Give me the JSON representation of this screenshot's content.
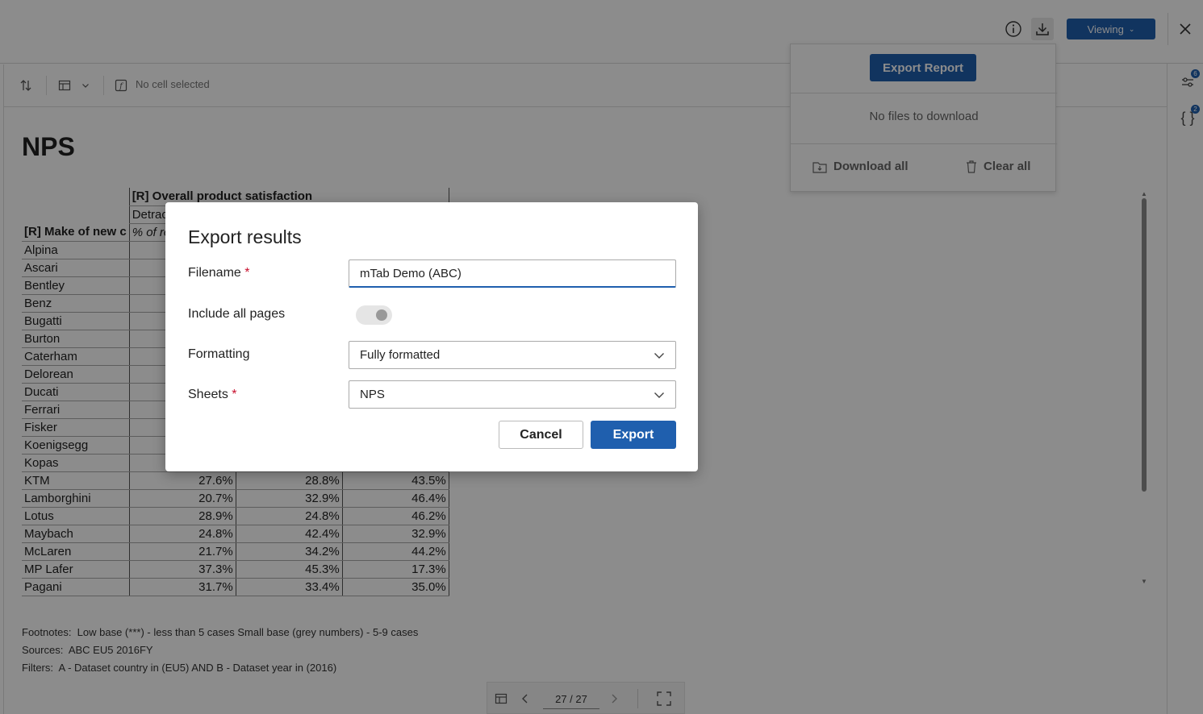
{
  "header": {
    "info_icon": "info-icon",
    "download_icon": "download-icon",
    "viewing_label": "Viewing",
    "close_icon": "close-icon"
  },
  "toolbar": {
    "sort_icon": "sort-icon",
    "table_icon": "table-icon",
    "formula_icon": "formula-icon",
    "cell_status": "No cell selected"
  },
  "right_rail": {
    "filters_badge": "6",
    "variables_badge": "2"
  },
  "page": {
    "title": "NPS",
    "column_header": "[R] Overall product satisfaction",
    "subheader_partial": "Detrac",
    "row_header_partial": "[R] Make of new c",
    "italic_header_partial": "% of ro"
  },
  "table": {
    "rows": [
      {
        "label": "Alpina",
        "values": [
          "",
          "",
          ""
        ]
      },
      {
        "label": "Ascari",
        "values": [
          "",
          "",
          ""
        ]
      },
      {
        "label": "Bentley",
        "values": [
          "",
          "",
          ""
        ]
      },
      {
        "label": "Benz",
        "values": [
          "",
          "",
          ""
        ]
      },
      {
        "label": "Bugatti",
        "values": [
          "",
          "",
          ""
        ]
      },
      {
        "label": "Burton",
        "values": [
          "",
          "",
          ""
        ]
      },
      {
        "label": "Caterham",
        "values": [
          "",
          "",
          ""
        ]
      },
      {
        "label": "Delorean",
        "values": [
          "",
          "",
          ""
        ]
      },
      {
        "label": "Ducati",
        "values": [
          "",
          "",
          ""
        ]
      },
      {
        "label": "Ferrari",
        "values": [
          "",
          "",
          ""
        ]
      },
      {
        "label": "Fisker",
        "values": [
          "",
          "",
          ""
        ]
      },
      {
        "label": "Koenigsegg",
        "values": [
          "",
          "",
          ""
        ]
      },
      {
        "label": "Kopas",
        "values": [
          "",
          "",
          ""
        ]
      },
      {
        "label": "KTM",
        "values": [
          "27.6%",
          "28.8%",
          "43.5%"
        ]
      },
      {
        "label": "Lamborghini",
        "values": [
          "20.7%",
          "32.9%",
          "46.4%"
        ]
      },
      {
        "label": "Lotus",
        "values": [
          "28.9%",
          "24.8%",
          "46.2%"
        ]
      },
      {
        "label": "Maybach",
        "values": [
          "24.8%",
          "42.4%",
          "32.9%"
        ]
      },
      {
        "label": "McLaren",
        "values": [
          "21.7%",
          "34.2%",
          "44.2%"
        ]
      },
      {
        "label": "MP Lafer",
        "values": [
          "37.3%",
          "45.3%",
          "17.3%"
        ]
      },
      {
        "label": "Pagani",
        "values": [
          "31.7%",
          "33.4%",
          "35.0%"
        ]
      }
    ]
  },
  "footnotes": {
    "footnotes_label": "Footnotes:",
    "footnotes_text": "Low base (***) - less than 5 cases Small base (grey numbers) - 5-9 cases",
    "sources_label": "Sources:",
    "sources_text": "ABC EU5 2016FY",
    "filters_label": "Filters:",
    "filters_text": "A - Dataset country in (EU5) AND B - Dataset year in (2016)"
  },
  "pager": {
    "page_value": "27 / 27"
  },
  "export_panel": {
    "export_report_label": "Export Report",
    "no_files_text": "No files to download",
    "download_all_label": "Download all",
    "clear_all_label": "Clear all"
  },
  "modal": {
    "title": "Export results",
    "filename_label": "Filename",
    "filename_value": "mTab Demo (ABC)",
    "include_all_pages_label": "Include all pages",
    "include_all_pages_on": false,
    "formatting_label": "Formatting",
    "formatting_value": "Fully formatted",
    "sheets_label": "Sheets",
    "sheets_value": "NPS",
    "required_marker": "*",
    "cancel_label": "Cancel",
    "export_label": "Export"
  },
  "colors": {
    "primary": "#1f5fae",
    "required": "#c8102e",
    "overlay": "rgba(0,0,0,0.45)"
  }
}
